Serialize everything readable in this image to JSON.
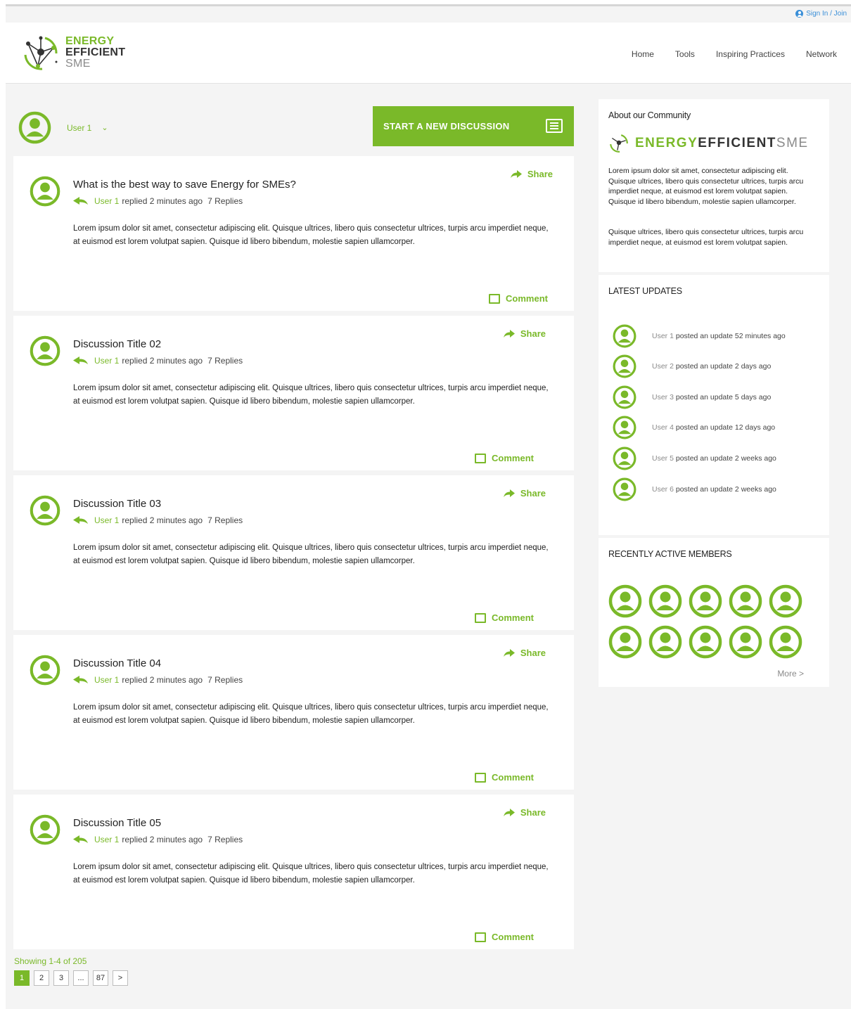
{
  "topbar": {
    "signin": "Sign In / Join"
  },
  "logo": {
    "line1": "ENERGY",
    "line2": "EFFICIENT",
    "line3": "SME"
  },
  "nav": [
    "Home",
    "Tools",
    "Inspiring Practices",
    "Network"
  ],
  "user": {
    "name": "User 1",
    "chevron": "⌄"
  },
  "start_discussion": "START A NEW DISCUSSION",
  "discussions": [
    {
      "title": "What is the best way to save Energy for SMEs?",
      "user": "User 1",
      "replied": "replied 2 minutes ago",
      "replies": "7 Replies",
      "body": "Lorem ipsum dolor sit amet, consectetur adipiscing elit. Quisque ultrices, libero quis consectetur ultrices, turpis arcu imperdiet neque, at euismod est lorem volutpat sapien. Quisque id libero bibendum, molestie sapien ullamcorper.",
      "share": "Share",
      "comment": "Comment"
    },
    {
      "title": "Discussion Title 02",
      "user": "User 1",
      "replied": "replied 2 minutes ago",
      "replies": "7 Replies",
      "body": "Lorem ipsum dolor sit amet, consectetur adipiscing elit. Quisque ultrices, libero quis consectetur ultrices, turpis arcu imperdiet neque, at euismod est lorem volutpat sapien. Quisque id libero bibendum, molestie sapien ullamcorper.",
      "share": "Share",
      "comment": "Comment"
    },
    {
      "title": "Discussion Title 03",
      "user": "User 1",
      "replied": "replied 2 minutes ago",
      "replies": "7 Replies",
      "body": "Lorem ipsum dolor sit amet, consectetur adipiscing elit. Quisque ultrices, libero quis consectetur ultrices, turpis arcu imperdiet neque, at euismod est lorem volutpat sapien. Quisque id libero bibendum, molestie sapien ullamcorper.",
      "share": "Share",
      "comment": "Comment"
    },
    {
      "title": "Discussion Title 04",
      "user": "User 1",
      "replied": "replied 2 minutes ago",
      "replies": "7 Replies",
      "body": "Lorem ipsum dolor sit amet, consectetur adipiscing elit. Quisque ultrices, libero quis consectetur ultrices, turpis arcu imperdiet neque, at euismod est lorem volutpat sapien. Quisque id libero bibendum, molestie sapien ullamcorper.",
      "share": "Share",
      "comment": "Comment"
    },
    {
      "title": "Discussion Title 05",
      "user": "User 1",
      "replied": "replied 2 minutes ago",
      "replies": "7 Replies",
      "body": "Lorem ipsum dolor sit amet, consectetur adipiscing elit. Quisque ultrices, libero quis consectetur ultrices, turpis arcu imperdiet neque, at euismod est lorem volutpat sapien. Quisque id libero bibendum, molestie sapien ullamcorper.",
      "share": "Share",
      "comment": "Comment"
    }
  ],
  "pagination": {
    "showing": "Showing 1-4 of 205",
    "pages": [
      "1",
      "2",
      "3",
      "...",
      "87",
      ">"
    ],
    "active": "1"
  },
  "about": {
    "title": "About our Community",
    "brand1": "ENERGY",
    "brand2": "EFFICIENT",
    "brand3": "SME",
    "p1": "Lorem ipsum dolor sit amet, consectetur adipiscing elit. Quisque ultrices, libero quis consectetur ultrices, turpis arcu imperdiet neque, at euismod est lorem volutpat sapien. Quisque id libero bibendum, molestie sapien ullamcorper.",
    "p2": "Quisque ultrices, libero quis consectetur ultrices, turpis arcu imperdiet neque, at euismod est lorem volutpat sapien."
  },
  "updates": {
    "title": "LATEST UPDATES",
    "items": [
      {
        "user": "User 1",
        "text": "posted an update 52 minutes ago"
      },
      {
        "user": "User 2",
        "text": "posted an update 2 days ago"
      },
      {
        "user": "User 3",
        "text": "posted an update 5 days ago"
      },
      {
        "user": "User 4",
        "text": "posted an update 12 days ago"
      },
      {
        "user": "User 5",
        "text": "posted an update 2 weeks ago"
      },
      {
        "user": "User 6",
        "text": "posted an update 2 weeks ago"
      }
    ]
  },
  "members": {
    "title": "RECENTLY ACTIVE MEMBERS",
    "more": "More >"
  },
  "colors": {
    "accent": "#7ab929",
    "link": "#3a8fd8"
  }
}
